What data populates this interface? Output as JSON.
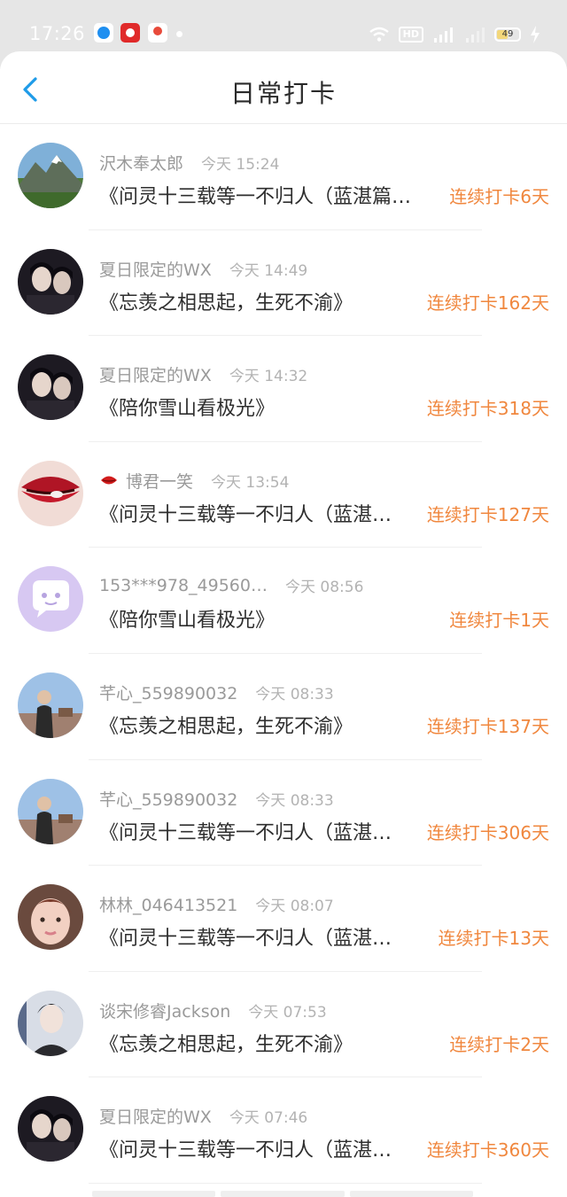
{
  "status_bar": {
    "time": "17:26",
    "hd_label": "HD",
    "battery": "49",
    "icons": [
      "app-blue-icon",
      "app-red-icon",
      "app-map-icon",
      "wifi-icon",
      "signal-icon",
      "battery-icon",
      "charging-icon"
    ]
  },
  "header": {
    "title": "日常打卡",
    "back_icon": "chevron-left-icon",
    "accent": "#1e9be8"
  },
  "colors": {
    "streak": "#f0873e",
    "name": "#9a9a9a",
    "title": "#2e2e2e"
  },
  "entries": [
    {
      "name": "沢木奉太郎",
      "time": "今天 15:24",
      "title": "《问灵十三载等一不归人（蓝湛篇…",
      "streak": "连续打卡6天",
      "avatar": "mountain"
    },
    {
      "name": "夏日限定的WX",
      "time": "今天 14:49",
      "title": "《忘羡之相思起，生死不渝》",
      "streak": "连续打卡162天",
      "avatar": "dark-portrait"
    },
    {
      "name": "夏日限定的WX",
      "time": "今天 14:32",
      "title": "《陪你雪山看极光》",
      "streak": "连续打卡318天",
      "avatar": "dark-portrait"
    },
    {
      "name": "博君一笑",
      "time": "今天 13:54",
      "title": "《问灵十三载等一不归人（蓝湛…",
      "streak": "连续打卡127天",
      "avatar": "lips",
      "badge_icon": "lips-icon"
    },
    {
      "name": "153***978_49560…",
      "time": "今天 08:56",
      "title": "《陪你雪山看极光》",
      "streak": "连续打卡1天",
      "avatar": "default-purple"
    },
    {
      "name": "芊心_559890032",
      "time": "今天 08:33",
      "title": "《忘羡之相思起，生死不渝》",
      "streak": "连续打卡137天",
      "avatar": "sky-portrait"
    },
    {
      "name": "芊心_559890032",
      "time": "今天 08:33",
      "title": "《问灵十三载等一不归人（蓝湛…",
      "streak": "连续打卡306天",
      "avatar": "sky-portrait"
    },
    {
      "name": "林林_046413521",
      "time": "今天 08:07",
      "title": "《问灵十三载等一不归人（蓝湛…",
      "streak": "连续打卡13天",
      "avatar": "face-pink"
    },
    {
      "name": "谈宋修睿Jackson",
      "time": "今天 07:53",
      "title": "《忘羡之相思起，生死不渝》",
      "streak": "连续打卡2天",
      "avatar": "light-portrait"
    },
    {
      "name": "夏日限定的WX",
      "time": "今天 07:46",
      "title": "《问灵十三载等一不归人（蓝湛…",
      "streak": "连续打卡360天",
      "avatar": "dark-portrait"
    }
  ]
}
